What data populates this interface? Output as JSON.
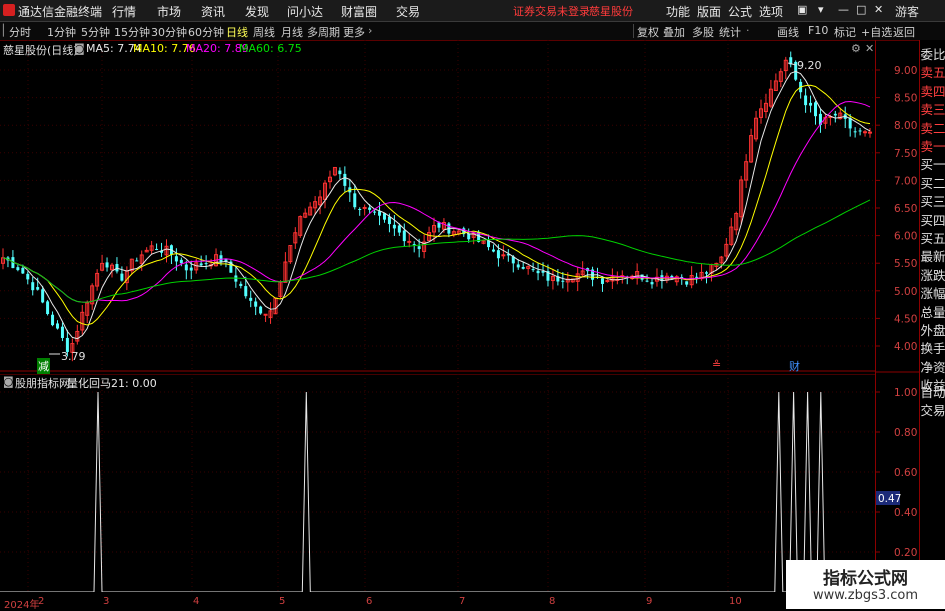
{
  "app": {
    "title": "通达信金融终端"
  },
  "menu": [
    "行情",
    "市场",
    "资讯",
    "发现",
    "问小达",
    "财富圈",
    "交易"
  ],
  "warning": "证券交易未登录",
  "stock_name": "慈星股份",
  "top_right": [
    "功能",
    "版面",
    "公式",
    "选项"
  ],
  "window_controls": [
    "▣",
    "▾",
    "—",
    "□",
    "✕"
  ],
  "user": "游客",
  "periods": [
    "分时",
    "1分钟",
    "5分钟",
    "15分钟",
    "30分钟",
    "60分钟",
    "日线",
    "周线",
    "月线",
    "多周期",
    "更多"
  ],
  "active_period": "日线",
  "tools": [
    "复权",
    "叠加",
    "多股",
    "统计",
    "画线",
    "F10",
    "标记",
    "+自选",
    "返回"
  ],
  "main_header": {
    "name": "慈星股份(日线)",
    "ma": [
      {
        "label": "MA5: 7.74",
        "color": "#e8e8e8"
      },
      {
        "label": "MA10: 7.76",
        "color": "#ffff00"
      },
      {
        "label": "MA20: 7.89",
        "color": "#ff00ff"
      },
      {
        "label": "MA60: 6.75",
        "color": "#00e000"
      }
    ]
  },
  "ind_header": {
    "name": "股朋指标网",
    "value": "量化回马21: 0.00"
  },
  "price_axis": [
    "9.00",
    "8.50",
    "8.00",
    "7.50",
    "7.00",
    "6.50",
    "6.00",
    "5.50",
    "5.00",
    "4.50",
    "4.00"
  ],
  "ind_axis": [
    "1.00",
    "0.80",
    "0.60",
    "0.40",
    "0.20"
  ],
  "ind_cursor": "0.47",
  "markers": {
    "low": "3.79",
    "high": "9.20",
    "jian": "减",
    "s": "≗",
    "cai": "财"
  },
  "dates": [
    "2024年",
    "2",
    "3",
    "4",
    "5",
    "6",
    "7",
    "8",
    "9",
    "10"
  ],
  "right_panel": [
    "委比",
    "卖五",
    "卖四",
    "卖三",
    "卖二",
    "卖一",
    "买一",
    "买二",
    "买三",
    "买四",
    "买五",
    "最新",
    "涨跌",
    "涨幅",
    "总量",
    "外盘",
    "换手",
    "净资",
    "收益",
    "自动",
    "交易"
  ],
  "watermark": {
    "line1": "指标公式网",
    "line2": "www.zbgs3.com"
  },
  "chart_data": [
    {
      "type": "candlestick",
      "title": "慈星股份(日线)",
      "ylim": [
        3.75,
        9.25
      ],
      "approx_price_path": [
        5.6,
        5.4,
        5.0,
        4.4,
        3.9,
        4.8,
        5.6,
        5.2,
        5.6,
        5.8,
        5.7,
        5.4,
        5.5,
        5.6,
        5.2,
        4.7,
        4.6,
        5.6,
        6.4,
        6.7,
        7.3,
        6.6,
        6.4,
        6.2,
        6.0,
        5.8,
        6.2,
        6.1,
        6.0,
        5.8,
        5.6,
        5.5,
        5.3,
        5.2,
        5.3,
        5.3,
        5.2,
        5.3,
        5.3,
        5.2,
        5.3,
        5.2,
        5.3,
        5.5,
        6.5,
        8.1,
        8.6,
        9.2,
        8.5,
        8.0,
        8.2,
        7.9,
        7.8
      ],
      "series": [
        {
          "name": "MA5",
          "last": 7.74
        },
        {
          "name": "MA10",
          "last": 7.76
        },
        {
          "name": "MA20",
          "last": 7.89
        },
        {
          "name": "MA60",
          "last": 6.75
        }
      ],
      "annotations": [
        {
          "label": "3.79"
        },
        {
          "label": "9.20"
        }
      ]
    },
    {
      "type": "line",
      "title": "股朋指标网",
      "series_name": "量化回马21",
      "last": 0.0,
      "ylim": [
        0,
        1.05
      ],
      "spikes_at_fraction": [
        0.112,
        0.35,
        0.89,
        0.907,
        0.923,
        0.938
      ],
      "spike_value": 1.0
    }
  ]
}
